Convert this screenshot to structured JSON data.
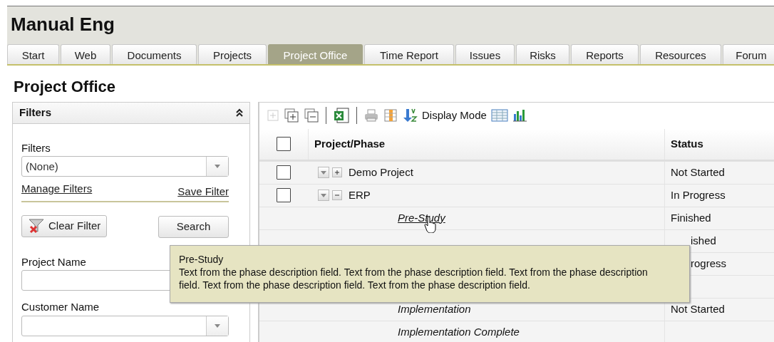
{
  "app": {
    "title": "Manual Eng"
  },
  "tabs": [
    {
      "label": "Start",
      "selected": false
    },
    {
      "label": "Web",
      "selected": false
    },
    {
      "label": "Documents",
      "selected": false
    },
    {
      "label": "Projects",
      "selected": false
    },
    {
      "label": "Project Office",
      "selected": true
    },
    {
      "label": "Time Report",
      "selected": false
    },
    {
      "label": "Issues",
      "selected": false
    },
    {
      "label": "Risks",
      "selected": false
    },
    {
      "label": "Reports",
      "selected": false
    },
    {
      "label": "Resources",
      "selected": false
    },
    {
      "label": "Forum",
      "selected": false
    }
  ],
  "page_title": "Project Office",
  "filters_panel": {
    "title": "Filters",
    "filter_label": "Filters",
    "filter_value": "(None)",
    "manage_link": "Manage Filters",
    "save_link": "Save Filter",
    "clear_button": "Clear Filter",
    "search_button": "Search",
    "fields": [
      {
        "label": "Project Name",
        "kind": "text"
      },
      {
        "label": "Customer Name",
        "kind": "select"
      }
    ]
  },
  "toolbar": {
    "display_mode": "Display Mode"
  },
  "grid": {
    "columns": [
      "Project/Phase",
      "Status"
    ],
    "header_checked": false,
    "rows": [
      {
        "kind": "project",
        "name": "Demo Project",
        "status": "Not Started",
        "expanded": false,
        "checked": false
      },
      {
        "kind": "project",
        "name": "ERP",
        "status": "In Progress",
        "expanded": true,
        "checked": false
      },
      {
        "kind": "phase",
        "name": "Pre-Study",
        "status": "Finished",
        "hovered": true
      },
      {
        "kind": "phase",
        "status": "ished",
        "covered": true
      },
      {
        "kind": "phase",
        "status": "rogress",
        "covered": true
      },
      {
        "kind": "phase"
      },
      {
        "kind": "phase",
        "name": "Implementation",
        "status": "Not Started"
      },
      {
        "kind": "phase",
        "name": "Implementation Complete"
      }
    ]
  },
  "tooltip": {
    "title": "Pre-Study",
    "text": "Text from the phase description field. Text from the phase description field. Text from the phase description field. Text from the phase description field. Text from the phase description field."
  }
}
